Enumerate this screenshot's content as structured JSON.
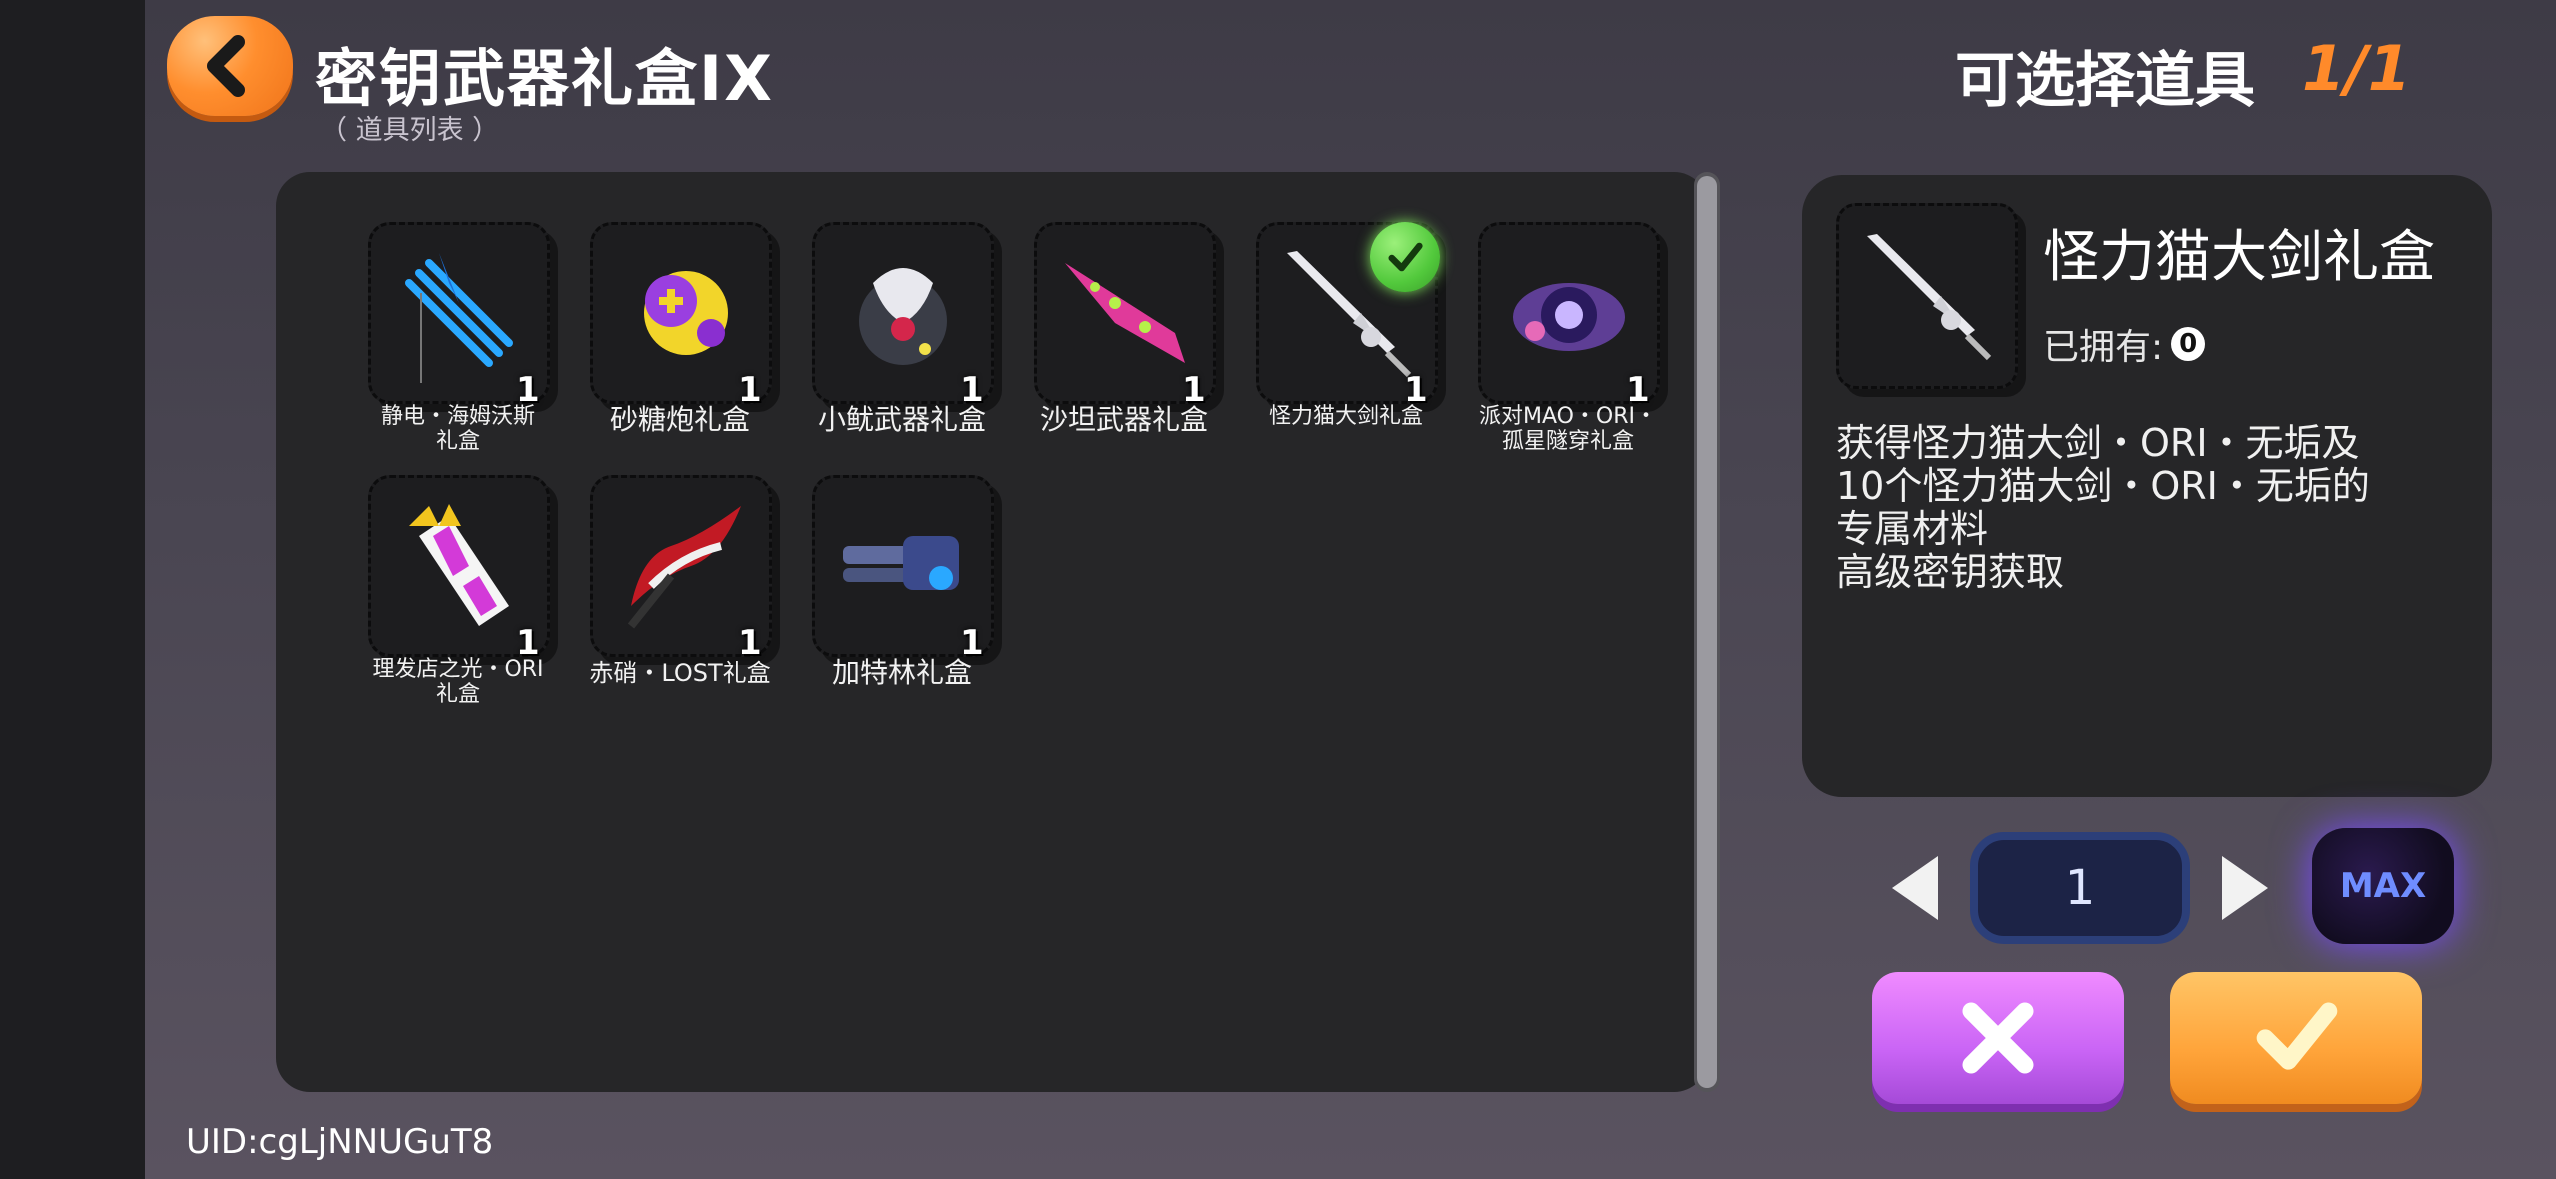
{
  "header": {
    "title": "密钥武器礼盒IX",
    "subtitle": "（ 道具列表 ）",
    "select_label": "可选择道具",
    "select_count": "1/1"
  },
  "items": [
    {
      "name": "静电・海姆沃斯\n礼盒",
      "qty": "1",
      "icon": "blue-trident-icon"
    },
    {
      "name": "砂糖炮礼盒",
      "qty": "1",
      "icon": "candy-cannon-icon"
    },
    {
      "name": "小鱿武器礼盒",
      "qty": "1",
      "icon": "squid-weapon-icon"
    },
    {
      "name": "沙坦武器礼盒",
      "qty": "1",
      "icon": "pink-blade-icon"
    },
    {
      "name": "怪力猫大剑礼盒",
      "qty": "1",
      "icon": "silver-greatsword-icon",
      "selected": true
    },
    {
      "name": "派对MAO・ORI・\n孤星隧穿礼盒",
      "qty": "1",
      "icon": "cosmic-orb-icon"
    },
    {
      "name": "理发店之光・ORI\n礼盒",
      "qty": "1",
      "icon": "barber-pole-icon"
    },
    {
      "name": "赤硝・LOST礼盒",
      "qty": "1",
      "icon": "red-scythe-icon"
    },
    {
      "name": "加特林礼盒",
      "qty": "1",
      "icon": "gatling-gun-icon"
    }
  ],
  "detail": {
    "name": "怪力猫大剑礼盒",
    "owned_label": "已拥有:",
    "owned_value": "0",
    "description": [
      "获得怪力猫大剑・ORI・无垢及",
      "10个怪力猫大剑・ORI・无垢的",
      "专属材料",
      "高级密钥获取"
    ]
  },
  "controls": {
    "quantity": "1",
    "max_label": "MAX"
  },
  "uid": "UID:cgLjNNUGuT8"
}
